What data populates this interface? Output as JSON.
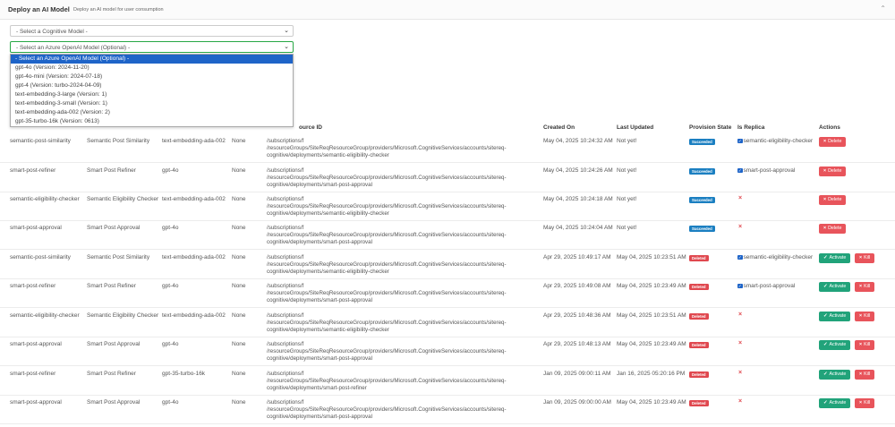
{
  "header": {
    "title": "Deploy an AI Model",
    "subtitle": "Deploy an AI model for user consumption",
    "collapse_icon": "chevron-up"
  },
  "cognitive_select": {
    "value": "- Select a Cognitive Model -"
  },
  "openai_select": {
    "value": "- Select an Azure OpenAI Model (Optional) -"
  },
  "dropdown_options": [
    "- Select an Azure OpenAI Model (Optional) -",
    "gpt-4o (Version: 2024-11-20)",
    "gpt-4o-mini (Version: 2024-07-18)",
    "gpt-4 (Version: turbo-2024-04-09)",
    "text-embedding-3-large (Version: 1)",
    "text-embedding-3-small (Version: 1)",
    "text-embedding-ada-002 (Version: 2)",
    "gpt-35-turbo-16k (Version: 0613)"
  ],
  "table": {
    "headers": {
      "resource_id": "ource ID",
      "created_on": "Created On",
      "last_updated": "Last Updated",
      "provision_state": "Provision State",
      "is_replica": "Is Replica",
      "actions": "Actions"
    },
    "rows": [
      {
        "name": "semantic-post-similarity",
        "display": "Semantic Post Similarity",
        "model": "text-embedding-ada-002",
        "scale": "None",
        "res1": "/subscriptions/f",
        "res2": "/resourceGroups/SiteReqResourceGroup/providers/Microsoft.CognitiveServices/accounts/sitereq-",
        "res3": "cognitive/deployments/semantic-eligibility-checker",
        "created": "May 04, 2025 10:24:32 AM",
        "updated": "Not yet!",
        "state": "Succeeded",
        "replica": "semantic-eligibility-checker",
        "actions": [
          "Delete"
        ]
      },
      {
        "name": "smart-post-refiner",
        "display": "Smart Post Refiner",
        "model": "gpt-4o",
        "scale": "None",
        "res1": "/subscriptions/f",
        "res2": "/resourceGroups/SiteReqResourceGroup/providers/Microsoft.CognitiveServices/accounts/sitereq-",
        "res3": "cognitive/deployments/smart-post-approval",
        "created": "May 04, 2025 10:24:26 AM",
        "updated": "Not yet!",
        "state": "Succeeded",
        "replica": "smart-post-approval",
        "actions": [
          "Delete"
        ]
      },
      {
        "name": "semantic-eligibility-checker",
        "display": "Semantic Eligibility Checker",
        "model": "text-embedding-ada-002",
        "scale": "None",
        "res1": "/subscriptions/f",
        "res2": "/resourceGroups/SiteReqResourceGroup/providers/Microsoft.CognitiveServices/accounts/sitereq-",
        "res3": "cognitive/deployments/semantic-eligibility-checker",
        "created": "May 04, 2025 10:24:18 AM",
        "updated": "Not yet!",
        "state": "Succeeded",
        "replica": "",
        "actions": [
          "Delete"
        ]
      },
      {
        "name": "smart-post-approval",
        "display": "Smart Post Approval",
        "model": "gpt-4o",
        "scale": "None",
        "res1": "/subscriptions/f",
        "res2": "/resourceGroups/SiteReqResourceGroup/providers/Microsoft.CognitiveServices/accounts/sitereq-",
        "res3": "cognitive/deployments/smart-post-approval",
        "created": "May 04, 2025 10:24:04 AM",
        "updated": "Not yet!",
        "state": "Succeeded",
        "replica": "",
        "actions": [
          "Delete"
        ]
      },
      {
        "name": "semantic-post-similarity",
        "display": "Semantic Post Similarity",
        "model": "text-embedding-ada-002",
        "scale": "None",
        "res1": "/subscriptions/f",
        "res2": "/resourceGroups/SiteReqResourceGroup/providers/Microsoft.CognitiveServices/accounts/sitereq-",
        "res3": "cognitive/deployments/semantic-eligibility-checker",
        "created": "Apr 29, 2025 10:49:17 AM",
        "updated": "May 04, 2025 10:23:51 AM",
        "state": "Deleted",
        "replica": "semantic-eligibility-checker",
        "actions": [
          "Activate",
          "Kill"
        ]
      },
      {
        "name": "smart-post-refiner",
        "display": "Smart Post Refiner",
        "model": "gpt-4o",
        "scale": "None",
        "res1": "/subscriptions/f",
        "res2": "/resourceGroups/SiteReqResourceGroup/providers/Microsoft.CognitiveServices/accounts/sitereq-",
        "res3": "cognitive/deployments/smart-post-approval",
        "created": "Apr 29, 2025 10:49:08 AM",
        "updated": "May 04, 2025 10:23:49 AM",
        "state": "Deleted",
        "replica": "smart-post-approval",
        "actions": [
          "Activate",
          "Kill"
        ]
      },
      {
        "name": "semantic-eligibility-checker",
        "display": "Semantic Eligibility Checker",
        "model": "text-embedding-ada-002",
        "scale": "None",
        "res1": "/subscriptions/f",
        "res2": "/resourceGroups/SiteReqResourceGroup/providers/Microsoft.CognitiveServices/accounts/sitereq-",
        "res3": "cognitive/deployments/semantic-eligibility-checker",
        "created": "Apr 29, 2025 10:48:36 AM",
        "updated": "May 04, 2025 10:23:51 AM",
        "state": "Deleted",
        "replica": "",
        "actions": [
          "Activate",
          "Kill"
        ]
      },
      {
        "name": "smart-post-approval",
        "display": "Smart Post Approval",
        "model": "gpt-4o",
        "scale": "None",
        "res1": "/subscriptions/f",
        "res2": "/resourceGroups/SiteReqResourceGroup/providers/Microsoft.CognitiveServices/accounts/sitereq-",
        "res3": "cognitive/deployments/smart-post-approval",
        "created": "Apr 29, 2025 10:48:13 AM",
        "updated": "May 04, 2025 10:23:49 AM",
        "state": "Deleted",
        "replica": "",
        "actions": [
          "Activate",
          "Kill"
        ]
      },
      {
        "name": "smart-post-refiner",
        "display": "Smart Post Refiner",
        "model": "gpt-35-turbo-16k",
        "scale": "None",
        "res1": "/subscriptions/f",
        "res2": "/resourceGroups/SiteReqResourceGroup/providers/Microsoft.CognitiveServices/accounts/sitereq-",
        "res3": "cognitive/deployments/smart-post-refiner",
        "created": "Jan 09, 2025 09:00:11 AM",
        "updated": "Jan 16, 2025 05:20:16 PM",
        "state": "Deleted",
        "replica": "",
        "actions": [
          "Activate",
          "Kill"
        ]
      },
      {
        "name": "smart-post-approval",
        "display": "Smart Post Approval",
        "model": "gpt-4o",
        "scale": "None",
        "res1": "/subscriptions/f",
        "res2": "/resourceGroups/SiteReqResourceGroup/providers/Microsoft.CognitiveServices/accounts/sitereq-",
        "res3": "cognitive/deployments/smart-post-approval",
        "created": "Jan 09, 2025 09:00:00 AM",
        "updated": "May 04, 2025 10:23:49 AM",
        "state": "Deleted",
        "replica": "",
        "actions": [
          "Activate",
          "Kill"
        ]
      }
    ]
  },
  "colors": {
    "succeeded": "#1b7fc1",
    "deleted": "#e0484f",
    "activate": "#21a37a",
    "kill": "#e8545b",
    "selected_option": "#1e64c8"
  }
}
